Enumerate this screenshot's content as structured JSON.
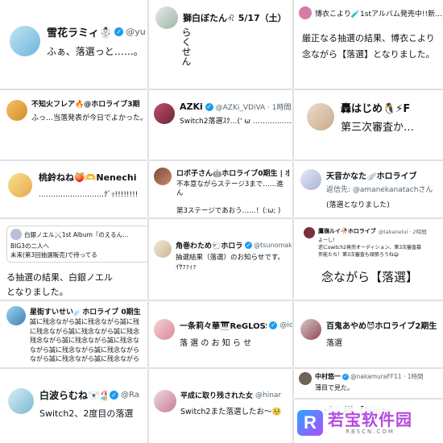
{
  "colors": {
    "verified": "#1d9bf0",
    "handle": "#536471",
    "link": "#1d9bf0"
  },
  "t1": {
    "name": "雪花ラミィ☃️",
    "handle": "@yu",
    "text": "ふぁ、落選っと……。"
  },
  "t2": {
    "name": "獅白ぼたん♌ 5/17（土）",
    "text": "らくせん"
  },
  "t3": {
    "name": "博衣こより🧪1stアルバム発売中!!新…",
    "text": "厳正なる抽選の結果、博衣こより\n念ながら【落選】となりました。"
  },
  "t4": {
    "name": "不知火フレア🔥@ホロライブ3期",
    "text": "ふっ…当落発表が今日でよかった。"
  },
  "t5": {
    "name": "AZKi",
    "handle": "@AZKi_VDiVA · 1時間",
    "text": "Switch2落選ｽｸ…(' ω   ………………"
  },
  "t6": {
    "name": "轟はじめ🐧⚡F",
    "text": "第三次審査か…"
  },
  "t7": {
    "name": "桃鈴ねね🍑🫶Nenechi",
    "text": "………………………ｸﾞｯ!!!!!!!!"
  },
  "t8": {
    "name": "ロボ子さん🤖ホロライブ0期生 | ホ",
    "text": "不本意ながらステージ3まで……進ん\n\n第3ステージであおう……！(:ω; )"
  },
  "t9": {
    "name": "天音かなた🪽ホロライブ",
    "reply_to": "返信先: @amanekanatachさん",
    "text": "(落選となりました)"
  },
  "t10": {
    "name": "白銀ノエル⚔️1st Album『のえるん…",
    "quote_1": "BIG3の二人へ",
    "quote_2": "未来(第3回抽選販売)で待ってる",
    "text": "る抽選の結果、白銀ノエル\nとなりました。"
  },
  "t11": {
    "name": "角巻わため🐑ホロライブ",
    "handle": "@tsunomakiw",
    "text": "抽選結果（落選）のお知らせです。\nｲﾔｧｧｨｧ"
  },
  "t12": {
    "name": "鷹嶺ルイ🥀ホロライブ",
    "handle": "@takaneluí · 2時間",
    "text": "よーし！\n逆にswitch2発売オーディション、第3次審査募\n伴能たち！第3次審査も頑張ろうね😄",
    "big": "念ながら【落選】"
  },
  "t13": {
    "name": "星街すいせい☄️ホロライブ 0期生",
    "text": "誠に残念ながら誠に残念ながら誠に残\nに残念ながら誠に残念ながら誠に残念\n残念ながら誠に残念ながら誠に残念な\nながら誠に残念ながら誠に残念ながら\nながら誠に残念ながら誠に残念ながら"
  },
  "t14": {
    "name": "一条莉々華🎹ReGLOSS",
    "handle": "@ic",
    "text": "落 選 の お 知 ら せ"
  },
  "t15": {
    "name": "百鬼あやめ😈ホロライブ2期生",
    "text": "落選"
  },
  "t16": {
    "name": "中村悠一",
    "handle": "@nakamuraFF11 · 1時間",
    "text": "薄目で見た。"
  },
  "t17": {
    "name": "白波らむね🐻‍❄️🏖️",
    "handle": "@Ra",
    "text": "Switch2、2度目の落選"
  },
  "t18": {
    "name": "平成に取り残された女",
    "handle": "@hinar",
    "text": "Switch2また落選したお〜🥺"
  },
  "t19": {
    "text": "ﾉ-ビル様【Ninte"
  },
  "watermark": {
    "logo": "R",
    "title": "若宝软件园",
    "url": "RBSCN.COM"
  }
}
